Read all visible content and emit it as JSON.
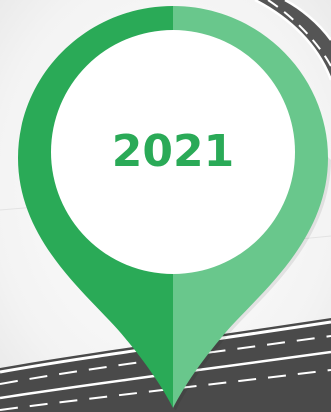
{
  "marker": {
    "year": "2021",
    "colors": {
      "pin_dark": "#2aaa57",
      "pin_light": "#69c78c",
      "disc": "#ffffff",
      "label": "#2aaa57",
      "road": "#4a4a4a",
      "road_marking": "#ffffff",
      "background": "#f2f2f2"
    }
  }
}
